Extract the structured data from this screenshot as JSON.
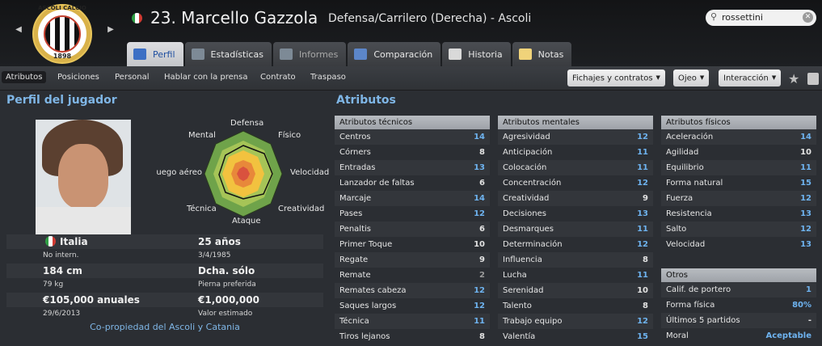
{
  "header": {
    "club_crest": {
      "top_text": "ASCOLI CALCIO",
      "year": "1898"
    },
    "player_title": "23. Marcello Gazzola",
    "player_subtitle": "Defensa/Carrilero (Derecha) - Ascoli",
    "search": {
      "value": "rossettini",
      "icon": "search-icon"
    },
    "tabs": [
      {
        "label": "Perfil",
        "icon": "profile-icon",
        "active": true
      },
      {
        "label": "Estadísticas",
        "icon": "stats-icon"
      },
      {
        "label": "Informes",
        "icon": "reports-icon",
        "dim": true
      },
      {
        "label": "Comparación",
        "icon": "compare-icon"
      },
      {
        "label": "Historia",
        "icon": "history-icon"
      },
      {
        "label": "Notas",
        "icon": "notes-icon"
      }
    ]
  },
  "subnav": {
    "items": [
      "Atributos",
      "Posiciones",
      "Personal",
      "Hablar con la prensa",
      "Contrato",
      "Traspaso"
    ],
    "buttons": [
      "Fichajes y contratos",
      "Ojeo",
      "Interacción"
    ]
  },
  "profile": {
    "title": "Perfil del jugador",
    "radar_labels": {
      "top": "Defensa",
      "top_right": "Físico",
      "right": "Velocidad",
      "bottom_right": "Creatividad",
      "bottom": "Ataque",
      "bottom_left": "Técnica",
      "left": "Juego aéreo",
      "top_left": "Mental"
    },
    "nationality": "Italia",
    "intl": "No intern.",
    "age": "25 años",
    "dob": "3/4/1985",
    "height": "184 cm",
    "weight": "79 kg",
    "foot": "Dcha. sólo",
    "foot_label": "Pierna preferida",
    "wage": "€105,000 anuales",
    "contract_end": "29/6/2013",
    "value": "€1,000,000",
    "value_label": "Valor estimado",
    "co_ownership": "Co-propiedad del Ascoli y Catania"
  },
  "attributes": {
    "title": "Atributos",
    "technical": {
      "header": "Atributos técnicos",
      "rows": [
        {
          "name": "Centros",
          "value": "14"
        },
        {
          "name": "Córners",
          "value": "8"
        },
        {
          "name": "Entradas",
          "value": "13"
        },
        {
          "name": "Lanzador de faltas",
          "value": "6"
        },
        {
          "name": "Marcaje",
          "value": "14"
        },
        {
          "name": "Pases",
          "value": "12"
        },
        {
          "name": "Penaltis",
          "value": "6"
        },
        {
          "name": "Primer Toque",
          "value": "10"
        },
        {
          "name": "Regate",
          "value": "9"
        },
        {
          "name": "Remate",
          "value": "2"
        },
        {
          "name": "Remates cabeza",
          "value": "12"
        },
        {
          "name": "Saques largos",
          "value": "12"
        },
        {
          "name": "Técnica",
          "value": "11"
        },
        {
          "name": "Tiros lejanos",
          "value": "8"
        }
      ]
    },
    "mental": {
      "header": "Atributos mentales",
      "rows": [
        {
          "name": "Agresividad",
          "value": "12"
        },
        {
          "name": "Anticipación",
          "value": "11"
        },
        {
          "name": "Colocación",
          "value": "11"
        },
        {
          "name": "Concentración",
          "value": "12"
        },
        {
          "name": "Creatividad",
          "value": "9"
        },
        {
          "name": "Decisiones",
          "value": "13"
        },
        {
          "name": "Desmarques",
          "value": "11"
        },
        {
          "name": "Determinación",
          "value": "12"
        },
        {
          "name": "Influencia",
          "value": "8"
        },
        {
          "name": "Lucha",
          "value": "11"
        },
        {
          "name": "Serenidad",
          "value": "10"
        },
        {
          "name": "Talento",
          "value": "8"
        },
        {
          "name": "Trabajo equipo",
          "value": "12"
        },
        {
          "name": "Valentía",
          "value": "15"
        }
      ]
    },
    "physical": {
      "header": "Atributos físicos",
      "rows": [
        {
          "name": "Aceleración",
          "value": "14"
        },
        {
          "name": "Agilidad",
          "value": "10"
        },
        {
          "name": "Equilibrio",
          "value": "11"
        },
        {
          "name": "Forma natural",
          "value": "15"
        },
        {
          "name": "Fuerza",
          "value": "12"
        },
        {
          "name": "Resistencia",
          "value": "13"
        },
        {
          "name": "Salto",
          "value": "12"
        },
        {
          "name": "Velocidad",
          "value": "13"
        }
      ]
    },
    "others": {
      "header": "Otros",
      "rows": [
        {
          "name": "Calif. de portero",
          "value": "1"
        },
        {
          "name": "Forma física",
          "value": "80%"
        },
        {
          "name": "Últimos 5 partidos",
          "value": "-"
        },
        {
          "name": "Moral",
          "value": "Aceptable"
        }
      ]
    }
  },
  "colors": {
    "accent_blue": "#6eb3f0",
    "title_blue": "#7fb6e6",
    "panel": "#2b2e33"
  }
}
